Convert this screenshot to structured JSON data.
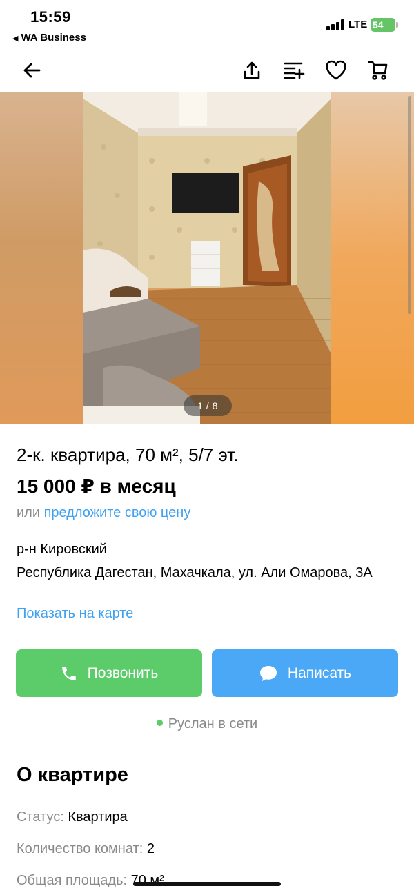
{
  "status_bar": {
    "time": "15:59",
    "back_app": "WA Business",
    "network": "LTE",
    "battery": "54"
  },
  "toolbar": {
    "back_icon": "arrow-left-icon",
    "share_icon": "share-icon",
    "compare_icon": "compare-list-icon",
    "favorite_icon": "heart-icon",
    "cart_icon": "cart-icon"
  },
  "gallery": {
    "counter": "1 / 8"
  },
  "listing": {
    "title": "2-к. квартира, 70 м², 5/7 эт.",
    "price": "15 000 ₽ в месяц",
    "offer_prefix": "или",
    "offer_link": "предложите свою цену",
    "district": "р-н Кировский",
    "address": "Республика Дагестан, Махачкала, ул. Али Омарова, 3А",
    "map_link": "Показать на карте"
  },
  "actions": {
    "call_label": "Позвонить",
    "message_label": "Написать"
  },
  "seller": {
    "online_text": "Руслан в сети"
  },
  "about": {
    "title": "О квартире",
    "params": [
      {
        "key": "Статус:",
        "value": "Квартира"
      },
      {
        "key": "Количество комнат:",
        "value": "2"
      },
      {
        "key": "Общая площадь:",
        "value": "70 м²"
      }
    ]
  },
  "colors": {
    "green": "#5ccc6a",
    "blue": "#4aa8f6",
    "link": "#3fa1f0",
    "muted": "#8a8a8a"
  }
}
